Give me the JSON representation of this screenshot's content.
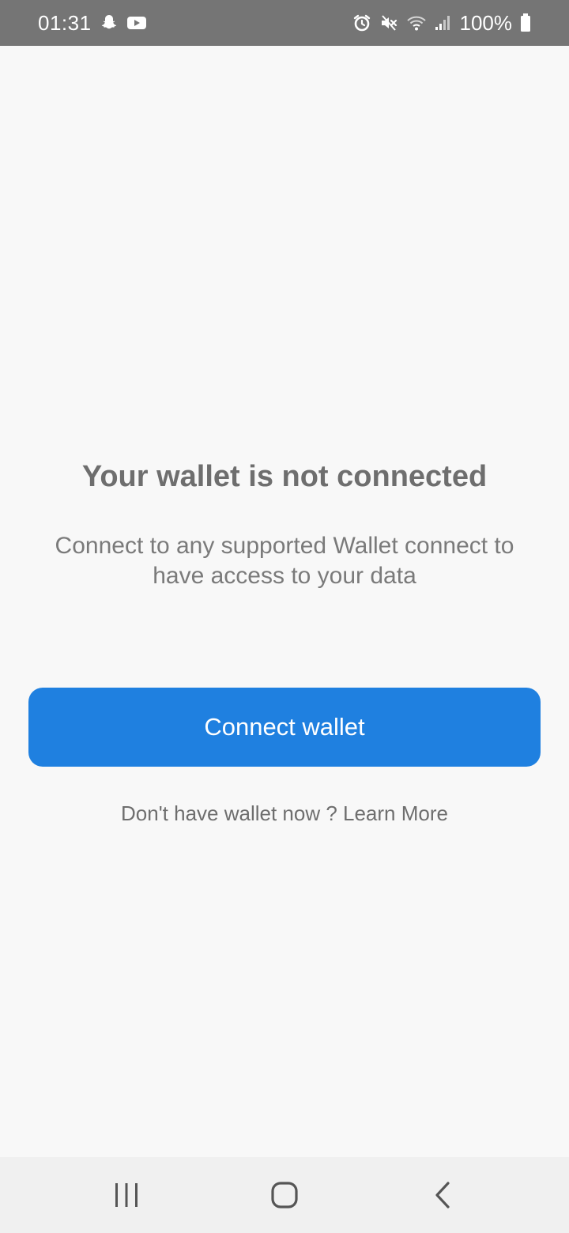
{
  "status_bar": {
    "time": "01:31",
    "battery_percent": "100%",
    "left_icons": [
      "snapchat-icon",
      "youtube-icon"
    ],
    "right_icons": [
      "alarm-icon",
      "mute-icon",
      "wifi-icon",
      "signal-icon",
      "battery-icon"
    ]
  },
  "main": {
    "headline": "Your wallet is not connected",
    "description": "Connect to any supported Wallet connect to have access to your data",
    "connect_button_label": "Connect wallet",
    "no_wallet_prefix": "Don't have wallet now ? ",
    "learn_more_label": "Learn More"
  },
  "nav_bar": {
    "buttons": [
      "recent-apps-icon",
      "home-icon",
      "back-icon"
    ]
  },
  "colors": {
    "status_bar_bg": "#757575",
    "background": "#f8f8f8",
    "accent": "#1f80e0",
    "text_primary": "#6e6e6e"
  }
}
